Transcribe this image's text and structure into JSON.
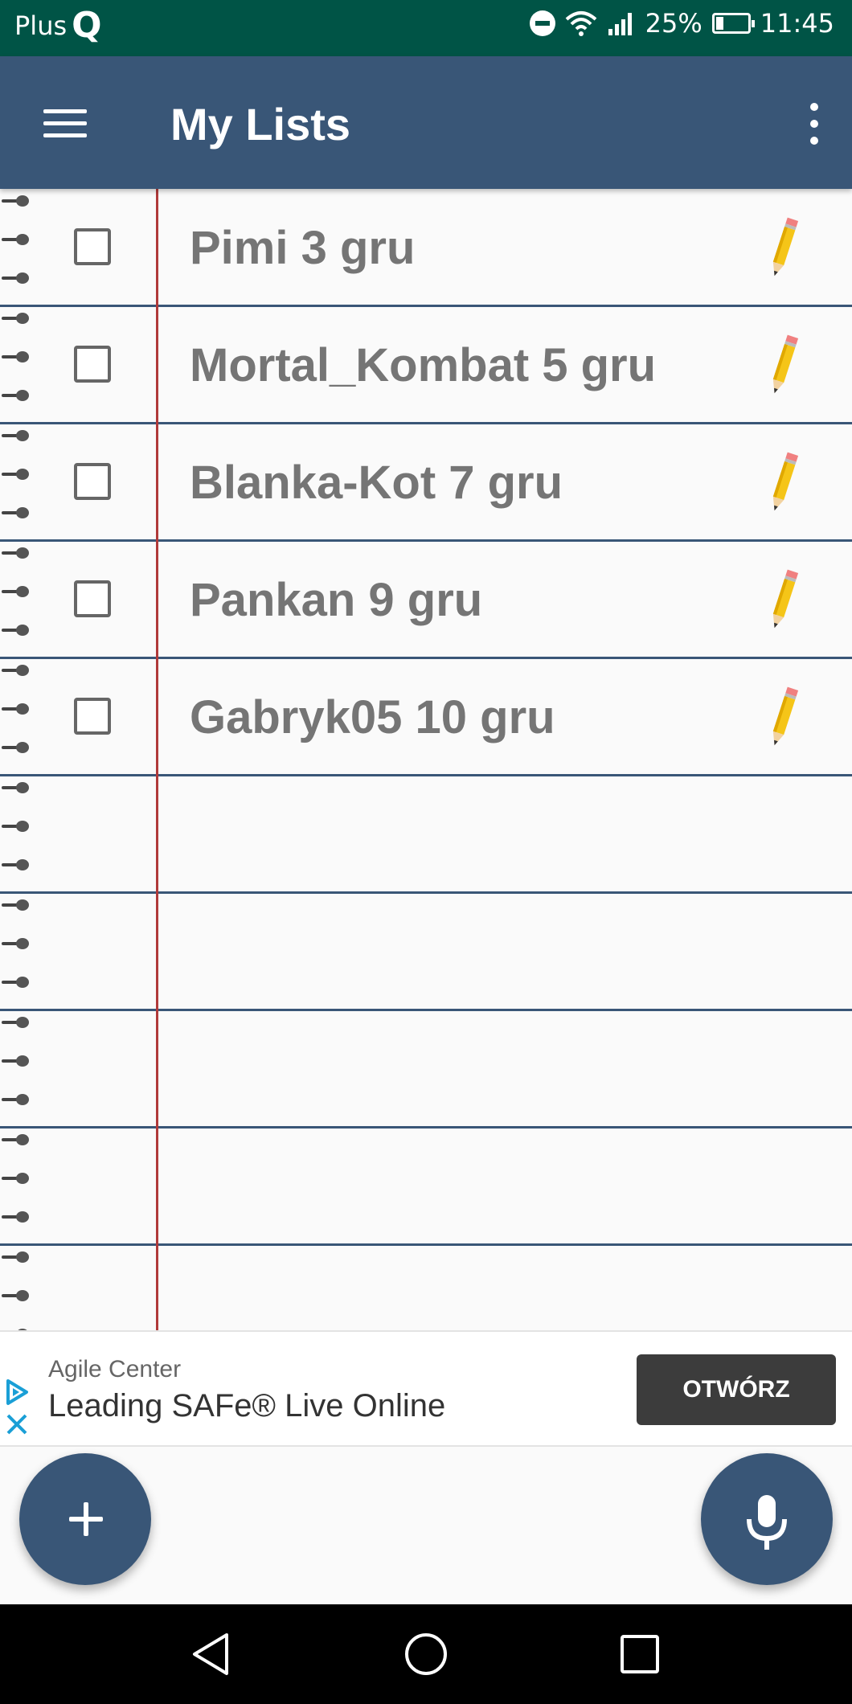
{
  "status_bar": {
    "carrier_prefix": "Plus",
    "carrier_logo": "Q",
    "battery": "25%",
    "time": "11:45",
    "icons": [
      "do-not-disturb-icon",
      "wifi-icon",
      "signal-icon",
      "battery-icon"
    ]
  },
  "app_bar": {
    "title": "My Lists",
    "icons": [
      "menu-icon",
      "more-vert-icon"
    ],
    "color": "#395677"
  },
  "lists": {
    "items": [
      {
        "label": "Pimi 3 gru",
        "checked": false
      },
      {
        "label": "Mortal_Kombat 5 gru",
        "checked": false
      },
      {
        "label": "Blanka-Kot 7 gru",
        "checked": false
      },
      {
        "label": "Pankan 9 gru",
        "checked": false
      },
      {
        "label": "Gabryk05 10 gru",
        "checked": false
      }
    ],
    "item_icons": [
      "checkbox-icon",
      "pencil-icon"
    ],
    "margin_line_color": "#b03a3a",
    "rule_color": "#395677"
  },
  "ad": {
    "brand": "Agile Center",
    "headline": "Leading SAFe® Live Online",
    "button_label": "OTWÓRZ",
    "icons": [
      "ad-choices-icon",
      "close-icon"
    ]
  },
  "fabs": {
    "icons": [
      "plus-icon",
      "microphone-icon"
    ]
  },
  "nav_bar": {
    "icons": [
      "back-icon",
      "home-icon",
      "recents-icon"
    ]
  }
}
